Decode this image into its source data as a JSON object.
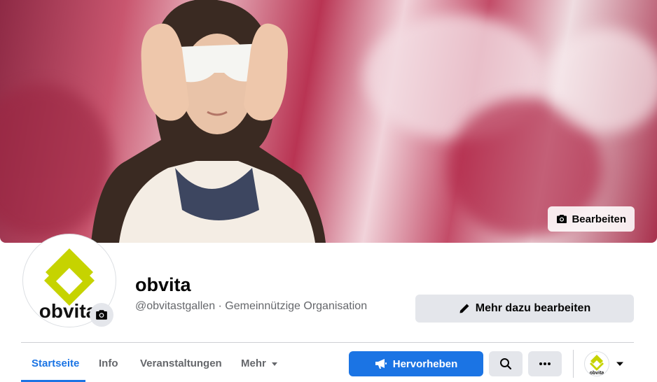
{
  "cover": {
    "edit_label": "Bearbeiten",
    "colors": {
      "accent": "#c34c68"
    }
  },
  "profile": {
    "name": "obvita",
    "subtitle": "@obvitastgallen · Gemeinnützige Organisation",
    "logo_text": "obvita",
    "logo_color": "#c6d300"
  },
  "actions": {
    "edit_more_label": "Mehr dazu bearbeiten",
    "promote_label": "Hervorheben"
  },
  "tabs": [
    {
      "label": "Startseite",
      "active": true
    },
    {
      "label": "Info",
      "active": false
    },
    {
      "label": "Veranstaltungen",
      "active": false
    },
    {
      "label": "Mehr",
      "active": false
    }
  ],
  "mini_logo_text": "obvita",
  "icons": {
    "cover_edit": "camera-icon",
    "avatar_edit": "camera-icon",
    "edit_more": "pencil-icon",
    "promote": "megaphone-icon",
    "search": "search-icon",
    "more": "ellipsis-icon",
    "menu": "caret-down-icon"
  },
  "colors": {
    "primary": "#1b74e4",
    "button_gray": "#e4e6eb",
    "text_secondary": "#65676b"
  }
}
